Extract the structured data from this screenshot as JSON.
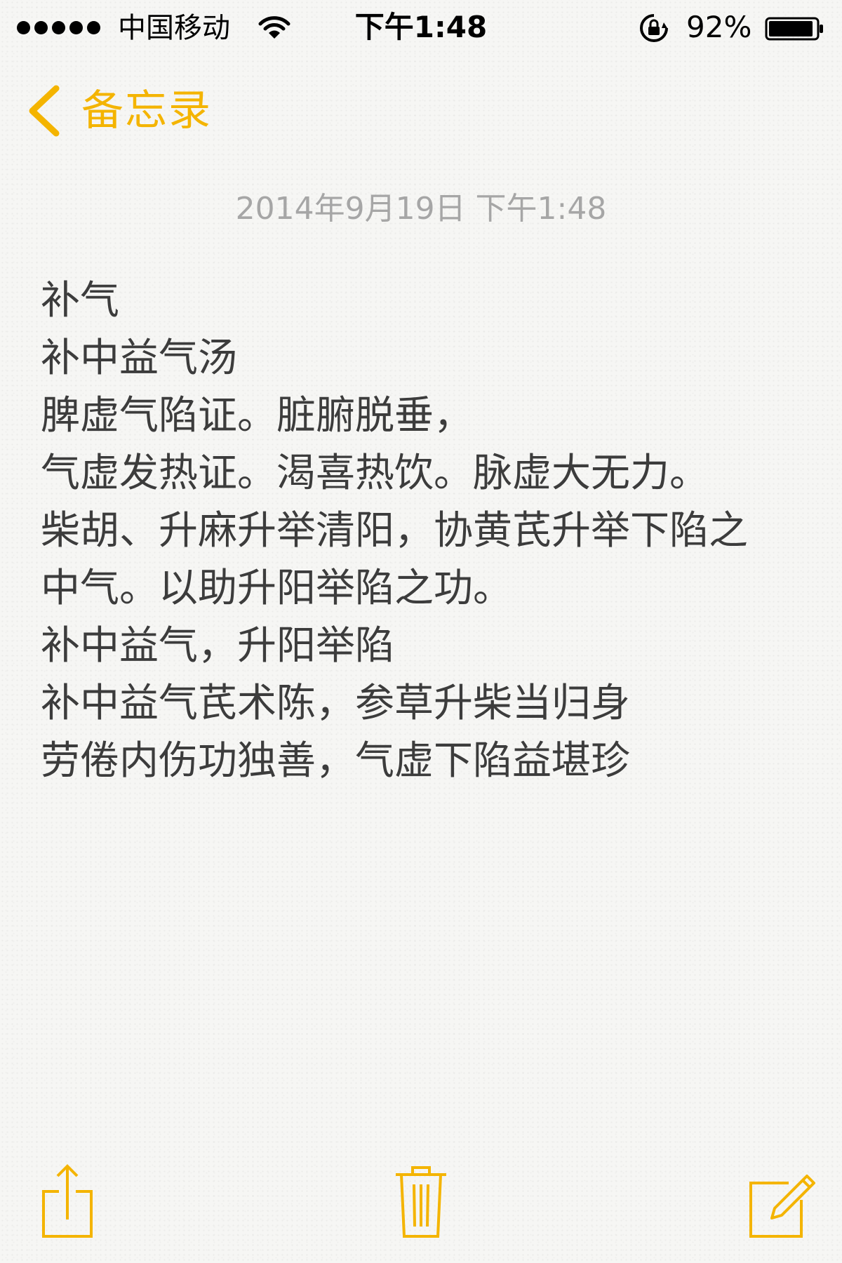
{
  "status_bar": {
    "carrier": "中国移动",
    "time": "下午1:48",
    "battery_percent": "92%",
    "signal_strength": 5
  },
  "nav": {
    "back_label": "备忘录"
  },
  "note": {
    "date": "2014年9月19日 下午1:48",
    "lines": [
      "补气",
      "补中益气汤",
      "脾虚气陷证。脏腑脱垂，",
      "气虚发热证。渴喜热饮。脉虚大无力。",
      "柴胡、升麻升举清阳，协黄芪升举下陷之中气。以助升阳举陷之功。",
      "补中益气，升阳举陷",
      "补中益气芪术陈，参草升柴当归身",
      "劳倦内伤功独善，气虚下陷益堪珍"
    ]
  },
  "toolbar": {
    "icons": [
      "share-icon",
      "trash-icon",
      "compose-icon"
    ]
  },
  "colors": {
    "accent": "#f4b400",
    "date_text": "#a6a6a6",
    "body_text": "#3c3c3c"
  }
}
